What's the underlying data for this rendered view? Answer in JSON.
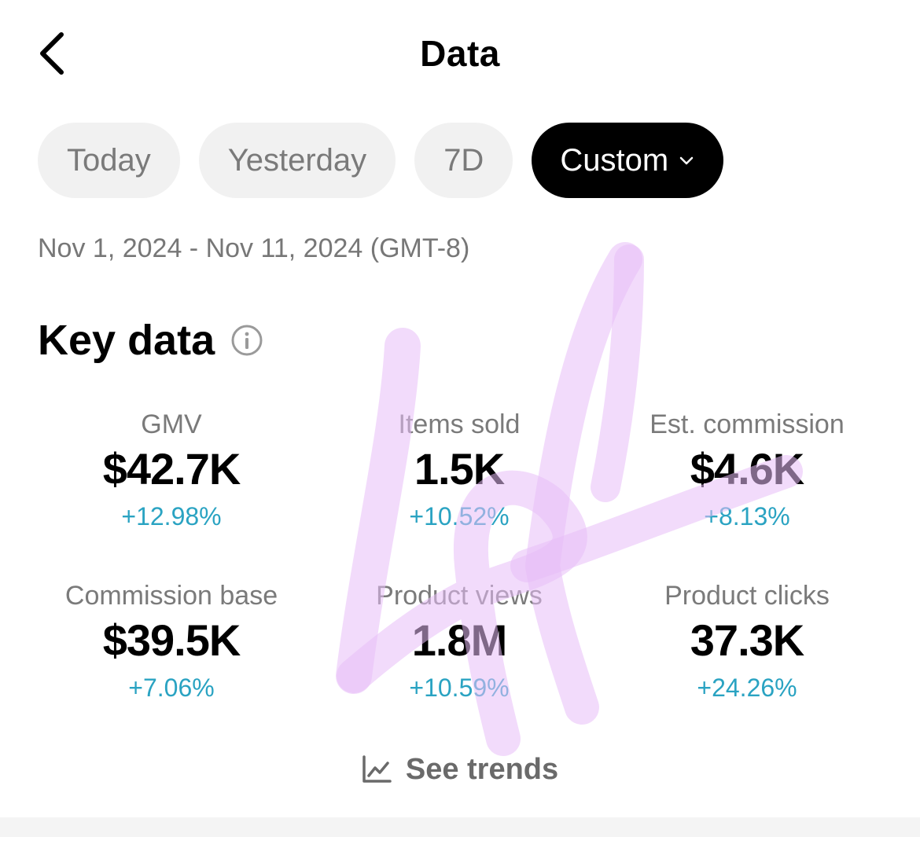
{
  "header": {
    "title": "Data",
    "back_icon": "chevron-left-icon"
  },
  "tabs": [
    {
      "label": "Today",
      "active": false
    },
    {
      "label": "Yesterday",
      "active": false
    },
    {
      "label": "7D",
      "active": false
    },
    {
      "label": "Custom",
      "active": true
    }
  ],
  "date_range": "Nov 1, 2024 - Nov 11, 2024 (GMT-8)",
  "key_data": {
    "title": "Key data",
    "info_icon": "info-icon",
    "metrics": [
      {
        "label": "GMV",
        "value": "$42.7K",
        "change": "+12.98%"
      },
      {
        "label": "Items sold",
        "value": "1.5K",
        "change": "+10.52%"
      },
      {
        "label": "Est. commission",
        "value": "$4.6K",
        "change": "+8.13%"
      },
      {
        "label": "Commission base",
        "value": "$39.5K",
        "change": "+7.06%"
      },
      {
        "label": "Product views",
        "value": "1.8M",
        "change": "+10.59%"
      },
      {
        "label": "Product clicks",
        "value": "37.3K",
        "change": "+24.26%"
      }
    ],
    "see_trends": "See trends",
    "trend_icon": "line-chart-icon"
  },
  "colors": {
    "accent_change": "#2aa3c2",
    "tab_active_bg": "#000000",
    "tab_inactive_bg": "#f1f1f1",
    "scribble": "#e6b8f5"
  }
}
